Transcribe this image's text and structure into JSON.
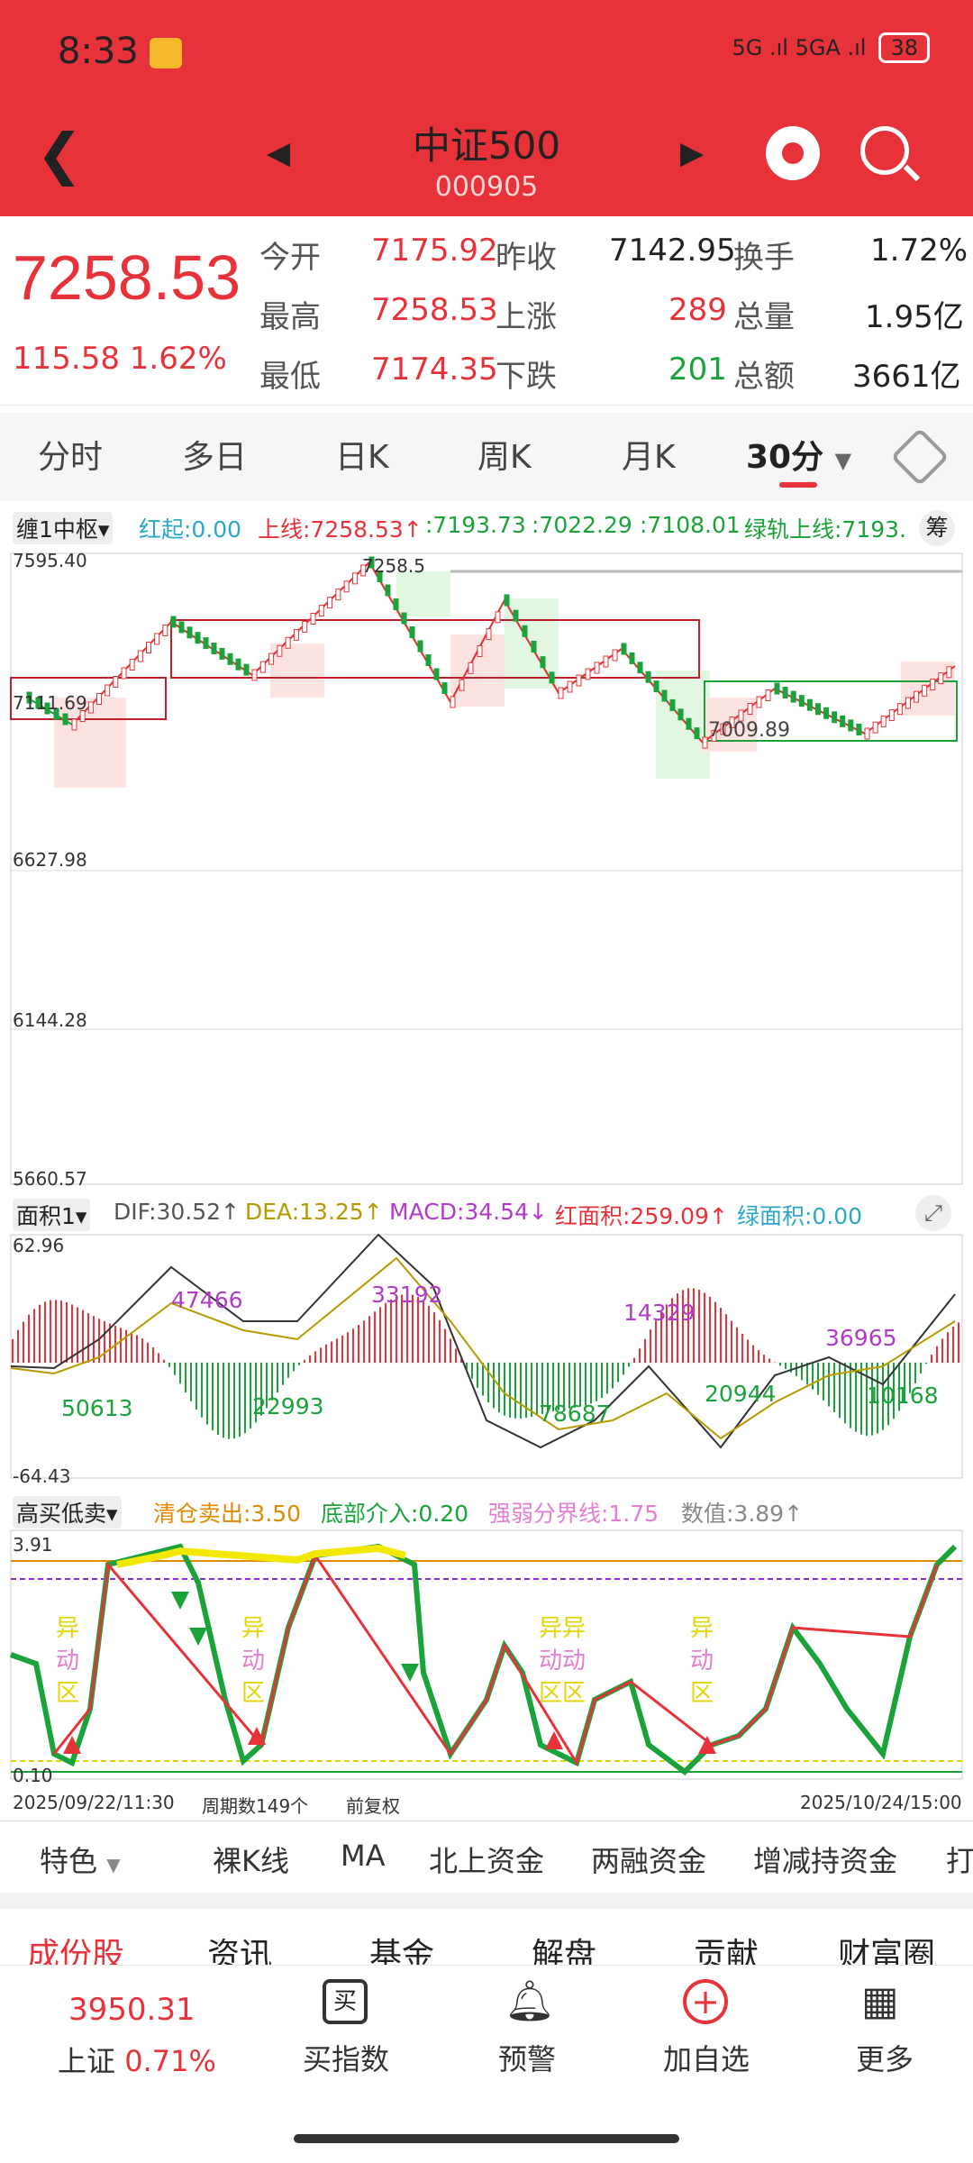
{
  "status_bar": {
    "time": "8:33",
    "network": "5G .ıl 5GA .ıl",
    "battery": "38"
  },
  "header": {
    "title": "中证500",
    "code": "000905"
  },
  "quote": {
    "price": "7258.53",
    "change": "115.58",
    "change_pct": "1.62%",
    "open_label": "今开",
    "open": "7175.92",
    "prev_label": "昨收",
    "prev": "7142.95",
    "turnover_label": "换手",
    "turnover": "1.72%",
    "high_label": "最高",
    "high": "7258.53",
    "up_label": "上涨",
    "up": "289",
    "volume_label": "总量",
    "volume": "1.95亿",
    "low_label": "最低",
    "low": "7174.35",
    "down_label": "下跌",
    "down": "201",
    "amount_label": "总额",
    "amount": "3661亿"
  },
  "tabs": [
    "分时",
    "多日",
    "日K",
    "周K",
    "月K",
    "30分"
  ],
  "main_chart": {
    "indicator": "缠1中枢",
    "hongqi": "红起:0.00",
    "upper": "上线:7258.53↑",
    "v1": ":7193.73",
    ":v2": ":7022.29",
    "v3": ":7108.01",
    "green_rail": "绿轨上线:7193.",
    "chou": "筹",
    "y_labels": [
      "7595.40",
      "6627.98",
      "6144.28",
      "5660.57"
    ],
    "mark1": "7111.69",
    "mark2": "7009.89",
    "peak": "7258.5"
  },
  "macd": {
    "indicator": "面积1",
    "dif": "DIF:30.52↑",
    "dea": "DEA:13.25↑",
    "macd": "MACD:34.54↓",
    "red_area": "红面积:259.09↑",
    "green_area": "绿面积:0.00",
    "y_top": "62.96",
    "y_bottom": "-64.43",
    "areas": [
      "50613",
      "47466",
      "22993",
      "33192",
      "78687",
      "14329",
      "20944",
      "36965",
      "10168"
    ]
  },
  "gmd": {
    "indicator": "高买低卖",
    "clear": "清仓卖出:3.50",
    "bottom": "底部介入:0.20",
    "divide": "强弱分界线:1.75",
    "value": "数值:3.89↑",
    "y_top": "3.91",
    "y_bottom": "0.10",
    "zone_char1": "异",
    "zone_char2": "动",
    "zone_char3": "区",
    "zone_double1": "异异",
    "zone_double2": "动动",
    "zone_double3": "区区",
    "date_start": "2025/09/22/11:30",
    "period": "周期数149个",
    "adjust": "前复权",
    "date_end": "2025/10/24/15:00"
  },
  "features": [
    "特色",
    "裸K线",
    "MA",
    "北上资金",
    "两融资金",
    "增减持资金",
    "打"
  ],
  "bottom_tabs": [
    "成份股",
    "资讯",
    "基金",
    "解盘",
    "贡献",
    "财富圈"
  ],
  "bottom_bar": {
    "sh_price": "3950.31",
    "sh_label": "上证",
    "sh_pct": "0.71%",
    "nav": [
      "买指数",
      "预警",
      "加自选",
      "更多"
    ],
    "buy_char": "买"
  }
}
